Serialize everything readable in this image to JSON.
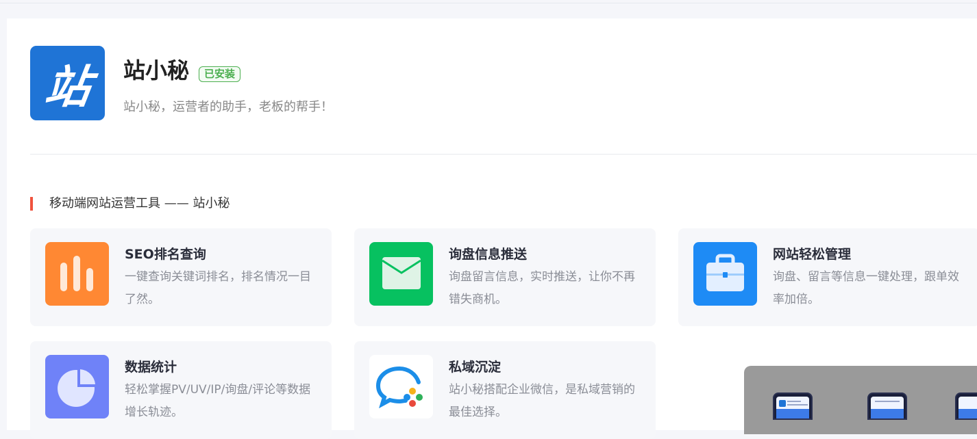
{
  "app": {
    "logo_char": "站",
    "name": "站小秘",
    "badge": "已安装",
    "description": "站小秘，运营者的助手，老板的帮手！"
  },
  "section": {
    "title": "移动端网站运营工具 —— 站小秘"
  },
  "features": [
    {
      "title": "SEO排名查询",
      "desc": "一键查询关键词排名，排名情况一目了然。",
      "icon": "bar-chart-icon",
      "color": "#ff8833"
    },
    {
      "title": "询盘信息推送",
      "desc": "询盘留言信息，实时推送，让你不再错失商机。",
      "icon": "mail-icon",
      "color": "#07c160"
    },
    {
      "title": "网站轻松管理",
      "desc": "询盘、留言等信息一键处理，跟单效率加倍。",
      "icon": "briefcase-icon",
      "color": "#1e8bf5"
    },
    {
      "title": "数据统计",
      "desc": "轻松掌握PV/UV/IP/询盘/评论等数据增长轨迹。",
      "icon": "pie-chart-icon",
      "color": "#6f82f8"
    },
    {
      "title": "私域沉淀",
      "desc": "站小秘搭配企业微信，是私域营销的最佳选择。",
      "icon": "wecom-icon",
      "color": "#ffffff"
    }
  ],
  "colors": {
    "brand_blue": "#1f74d6",
    "installed_green": "#4caf50",
    "section_accent": "#f0533e"
  }
}
